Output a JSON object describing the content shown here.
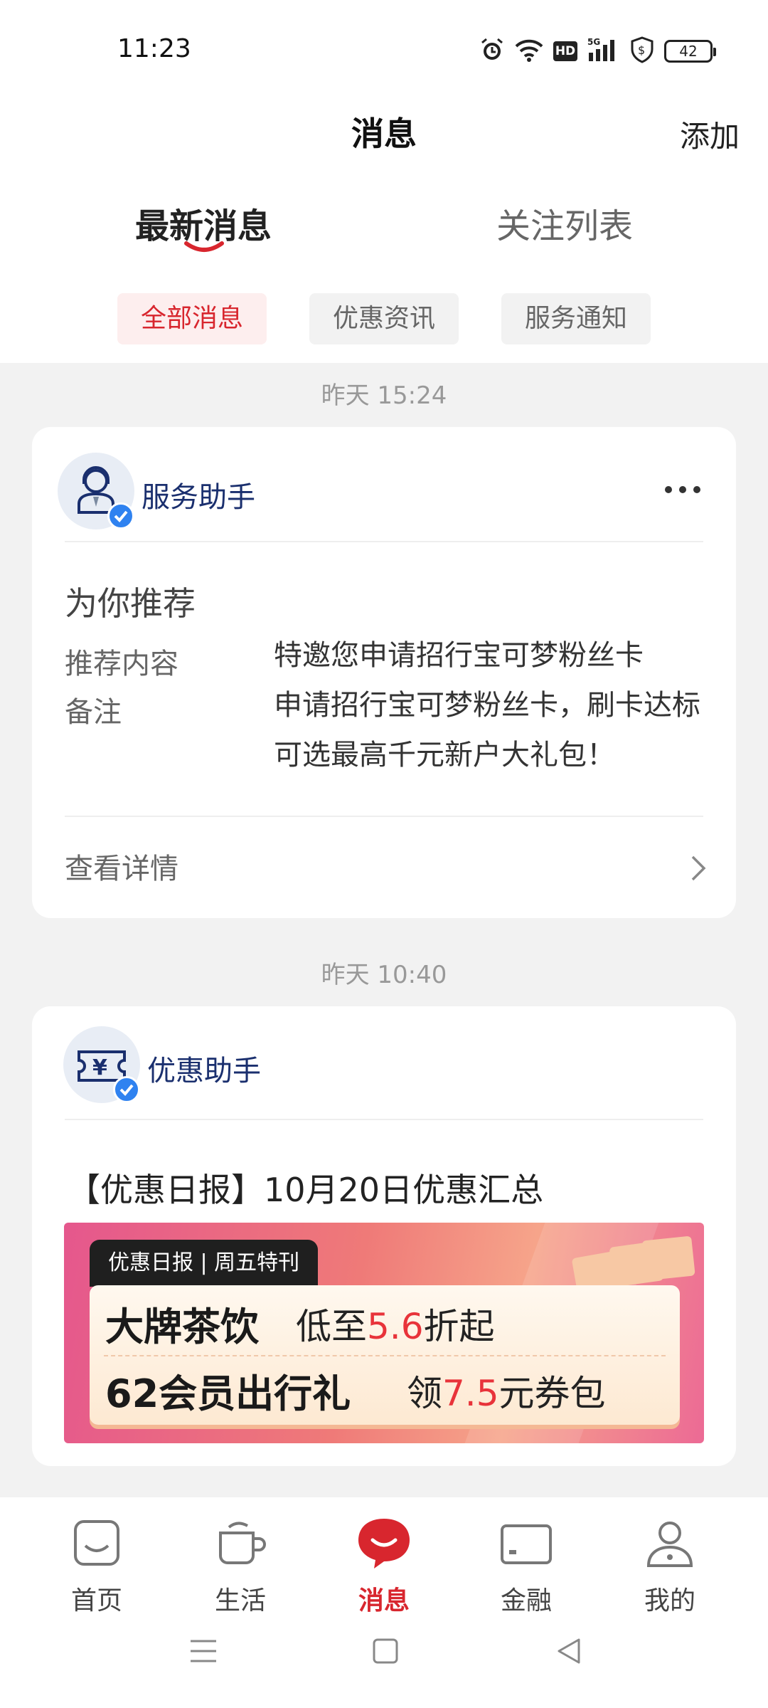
{
  "status_bar": {
    "time": "11:23",
    "battery": "42",
    "hd": "HD",
    "network": "5G"
  },
  "header": {
    "title": "消息",
    "add_label": "添加"
  },
  "tabs": [
    {
      "label": "最新消息",
      "active": true
    },
    {
      "label": "关注列表",
      "active": false
    }
  ],
  "filters": [
    {
      "label": "全部消息",
      "active": true
    },
    {
      "label": "优惠资讯",
      "active": false
    },
    {
      "label": "服务通知",
      "active": false
    }
  ],
  "messages": [
    {
      "timestamp": "昨天 15:24",
      "sender": "服务助手",
      "title": "为你推荐",
      "rows": [
        {
          "label": "推荐内容",
          "value": "特邀您申请招行宝可梦粉丝卡"
        },
        {
          "label": "备注",
          "value": "申请招行宝可梦粉丝卡，刷卡达标可选最高千元新户大礼包！"
        }
      ],
      "action": "查看详情"
    },
    {
      "timestamp": "昨天 10:40",
      "sender": "优惠助手",
      "title": "【优惠日报】10月20日优惠汇总",
      "banner": {
        "tag": "优惠日报 | 周五特刊",
        "line1_bold": "大牌茶饮",
        "line1_pre": "低至",
        "line1_num": "5.6",
        "line1_post": "折起",
        "line2_bold": "62会员出行礼",
        "line2_pre": "领",
        "line2_num": "7.5",
        "line2_post": "元券包"
      }
    }
  ],
  "bottom_nav": [
    {
      "label": "首页",
      "icon": "home-icon",
      "active": false
    },
    {
      "label": "生活",
      "icon": "cup-icon",
      "active": false
    },
    {
      "label": "消息",
      "icon": "message-icon",
      "active": true
    },
    {
      "label": "金融",
      "icon": "card-icon",
      "active": false
    },
    {
      "label": "我的",
      "icon": "profile-icon",
      "active": false
    }
  ],
  "colors": {
    "accent": "#d8262e",
    "sender": "#1a2f6e",
    "verified": "#2f82f0"
  }
}
